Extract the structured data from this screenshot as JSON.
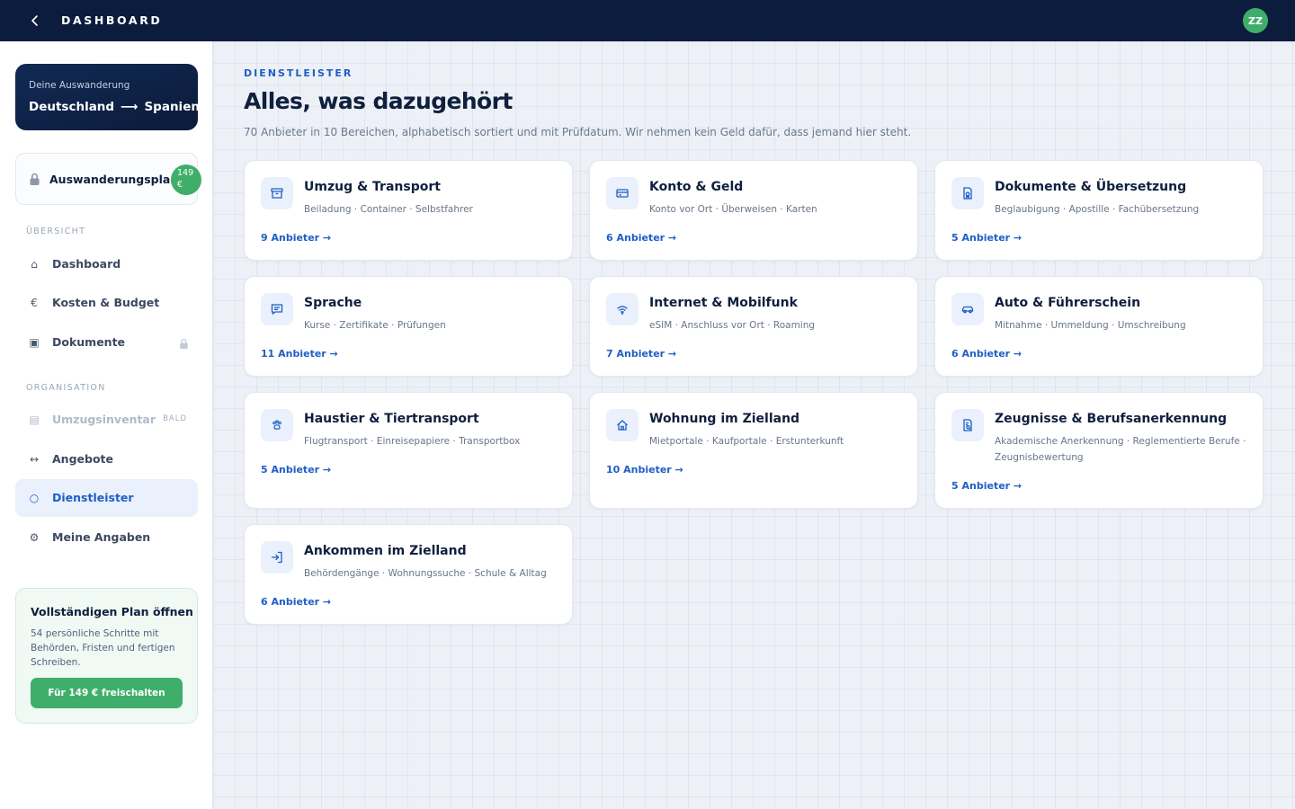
{
  "topbar": {
    "title": "DASHBOARD",
    "back_icon": "chevron-left-icon",
    "avatar": "ZZ"
  },
  "sidebar": {
    "route": {
      "label": "Deine Auswanderung",
      "from": "Deutschland",
      "arrow": "⟶",
      "to": "Spanien"
    },
    "plan": {
      "label": "Auswanderungsplan",
      "price_amount": "149",
      "price_currency": "€",
      "icon": "lock-icon"
    },
    "sections": [
      {
        "label": "ÜBERSICHT",
        "items": [
          {
            "label": "Dashboard",
            "icon": "home-icon",
            "glyph": "⌂"
          },
          {
            "label": "Kosten & Budget",
            "icon": "euro-icon",
            "glyph": "€"
          },
          {
            "label": "Dokumente",
            "icon": "document-icon",
            "glyph": "▣",
            "locked": true
          }
        ]
      },
      {
        "label": "ORGANISATION",
        "items": [
          {
            "label": "Umzugsinventar",
            "icon": "inventory-icon",
            "glyph": "▤",
            "badge": "BALD",
            "disabled": true
          },
          {
            "label": "Angebote",
            "icon": "compare-icon",
            "glyph": "↔"
          },
          {
            "label": "Dienstleister",
            "icon": "circle-icon",
            "glyph": "○",
            "active": true
          },
          {
            "label": "Meine Angaben",
            "icon": "gear-icon",
            "glyph": "⚙"
          }
        ]
      }
    ],
    "upsell": {
      "title": "Vollständigen Plan öffnen",
      "text": "54 persönliche Schritte mit Behörden, Fristen und fertigen Schreiben.",
      "button": "Für 149 € freischalten"
    }
  },
  "main": {
    "eyebrow": "DIENSTLEISTER",
    "title": "Alles, was dazugehört",
    "subtitle": "70 Anbieter in 10 Bereichen, alphabetisch sortiert und mit Prüfdatum. Wir nehmen kein Geld dafür, dass jemand hier steht.",
    "categories": [
      {
        "title": "Umzug & Transport",
        "tags": "Beiladung · Container · Selbstfahrer",
        "link": "9 Anbieter →",
        "icon": "box-icon"
      },
      {
        "title": "Konto & Geld",
        "tags": "Konto vor Ort · Überweisen · Karten",
        "link": "6 Anbieter →",
        "icon": "credit-card-icon"
      },
      {
        "title": "Dokumente & Übersetzung",
        "tags": "Beglaubigung · Apostille · Fachübersetzung",
        "link": "5 Anbieter →",
        "icon": "certified-document-icon"
      },
      {
        "title": "Sprache",
        "tags": "Kurse · Zertifikate · Prüfungen",
        "link": "11 Anbieter →",
        "icon": "chat-bubble-icon"
      },
      {
        "title": "Internet & Mobilfunk",
        "tags": "eSIM · Anschluss vor Ort · Roaming",
        "link": "7 Anbieter →",
        "icon": "wifi-icon"
      },
      {
        "title": "Auto & Führerschein",
        "tags": "Mitnahme · Ummeldung · Umschreibung",
        "link": "6 Anbieter →",
        "icon": "car-icon"
      },
      {
        "title": "Haustier & Tiertransport",
        "tags": "Flugtransport · Einreisepapiere · Transportbox",
        "link": "5 Anbieter →",
        "icon": "paw-icon"
      },
      {
        "title": "Wohnung im Zielland",
        "tags": "Mietportale · Kaufportale · Erstunterkunft",
        "link": "10 Anbieter →",
        "icon": "house-icon"
      },
      {
        "title": "Zeugnisse & Berufsanerkennung",
        "tags": "Akademische Anerkennung · Reglementierte Berufe · Zeugnisbewertung",
        "link": "5 Anbieter →",
        "icon": "document-search-icon"
      },
      {
        "title": "Ankommen im Zielland",
        "tags": "Behördengänge · Wohnungssuche · Schule & Alltag",
        "link": "6 Anbieter →",
        "icon": "sign-in-icon"
      }
    ]
  }
}
